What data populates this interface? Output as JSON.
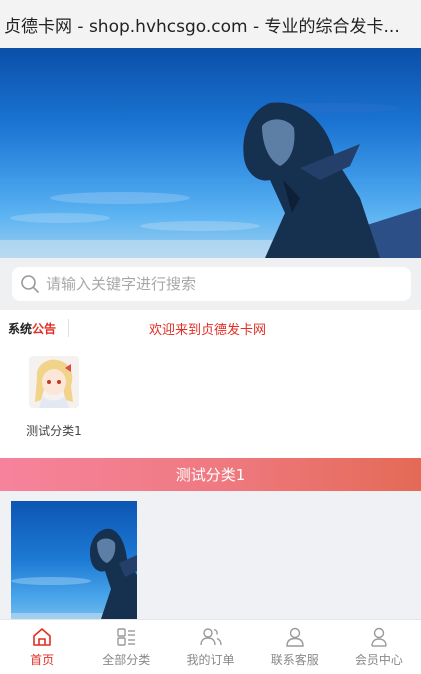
{
  "window": {
    "title": "贞德卡网 - shop.hvhcsgo.com - 专业的综合发卡..."
  },
  "search": {
    "placeholder": "请输入关键字进行搜索",
    "icon": "search-icon"
  },
  "notice": {
    "label_prefix": "系统",
    "label_suffix": "公告",
    "text": "欢迎来到贞德发卡网"
  },
  "categories": [
    {
      "label": "测试分类1",
      "icon": "anime-girl-thumbnail"
    }
  ],
  "section": {
    "title": "测试分类1"
  },
  "colors": {
    "accent": "#e02e24",
    "gradient_start": "#f6839c",
    "gradient_end": "#e46a56"
  },
  "tabbar": {
    "items": [
      {
        "label": "首页",
        "icon": "home-icon",
        "active": true
      },
      {
        "label": "全部分类",
        "icon": "category-icon",
        "active": false
      },
      {
        "label": "我的订单",
        "icon": "orders-icon",
        "active": false
      },
      {
        "label": "联系客服",
        "icon": "support-icon",
        "active": false
      },
      {
        "label": "会员中心",
        "icon": "member-icon",
        "active": false
      }
    ]
  }
}
